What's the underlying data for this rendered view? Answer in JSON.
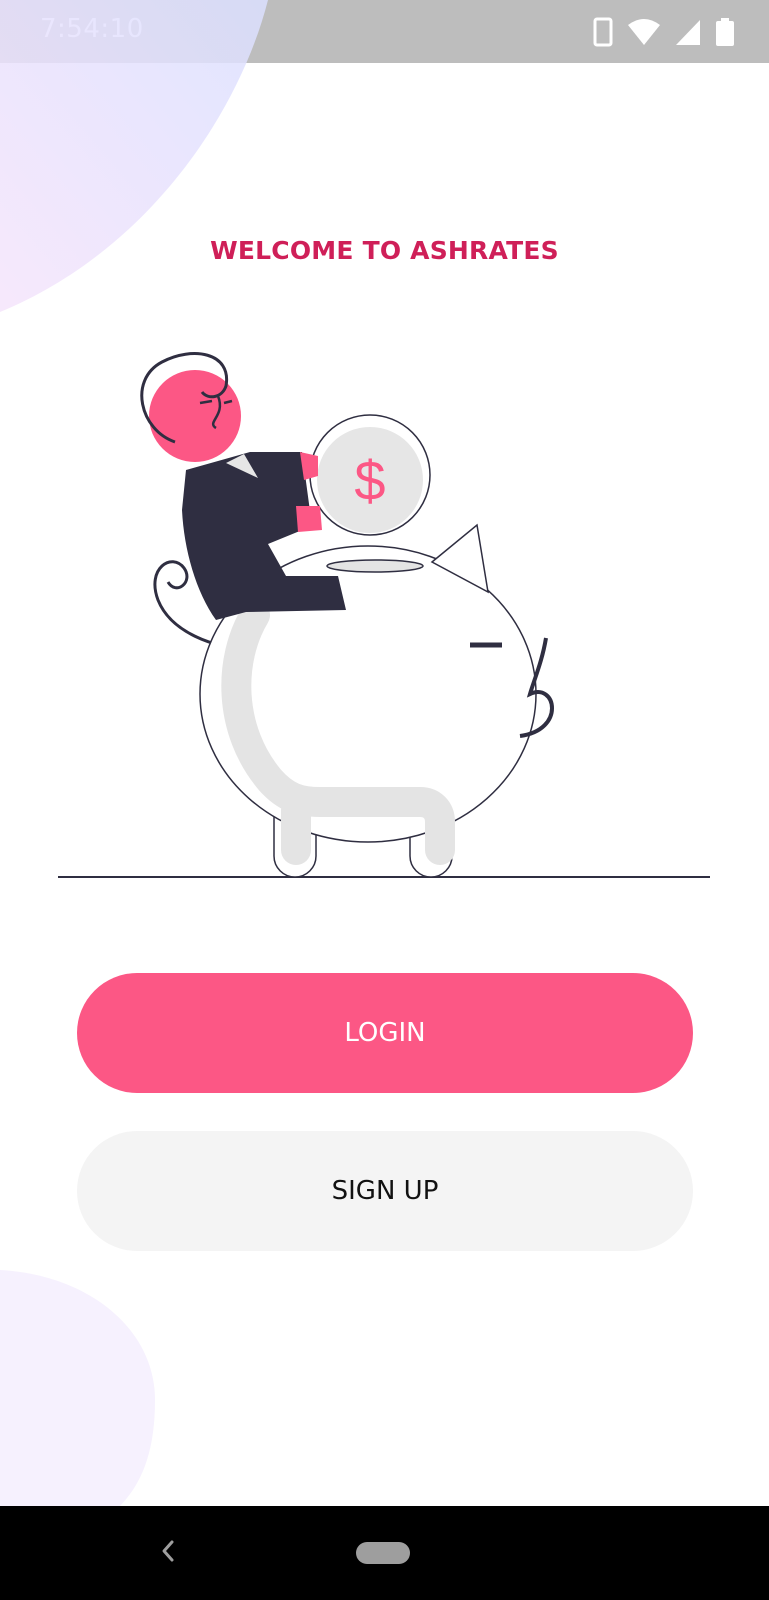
{
  "status_bar": {
    "time": "7:54:10",
    "icons": [
      "phone-icon",
      "wifi-icon",
      "signal-icon",
      "battery-icon"
    ]
  },
  "welcome": {
    "title": "WELCOME TO ASHRATES"
  },
  "illustration": {
    "description_icon": "piggy-bank-illustration",
    "coin_symbol": "$"
  },
  "actions": {
    "login_label": "LOGIN",
    "signup_label": "SIGN UP"
  },
  "nav_bar": {
    "icons": [
      "back-icon",
      "home-icon"
    ]
  },
  "colors": {
    "accent": "#fc5785",
    "title": "#cf1f58",
    "secondary_button": "#f4f4f4",
    "dark": "#2f2e41"
  }
}
